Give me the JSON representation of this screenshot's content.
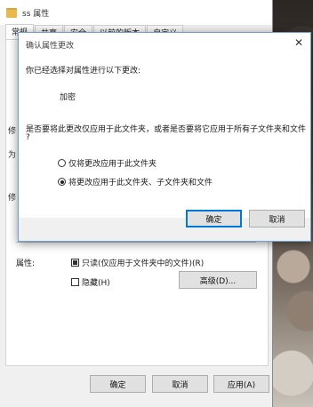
{
  "window": {
    "title": "ss 属性",
    "tabs": [
      "常规",
      "共享",
      "安全",
      "以前的版本",
      "自定义"
    ],
    "behind_fragments": [
      "修",
      "为",
      "修"
    ]
  },
  "attributes": {
    "label": "属性:",
    "readonly_label": "只读(仅应用于文件夹中的文件)(R)",
    "readonly_state": "mixed",
    "hidden_label": "隐藏(H)",
    "hidden_state": "unchecked",
    "advanced_button": "高级(D)..."
  },
  "footer": {
    "ok": "确定",
    "cancel": "取消",
    "apply": "应用(A)"
  },
  "dialog": {
    "title": "确认属性更改",
    "close_glyph": "✕",
    "intro": "你已经选择对属性进行以下更改:",
    "change": "加密",
    "question_line1": "是否要将此更改仅应用于此文件夹，或者是否要将它应用于所有子文件夹和文件",
    "question_line2": "?",
    "options": [
      {
        "label": "仅将更改应用于此文件夹",
        "selected": false
      },
      {
        "label": "将更改应用于此文件夹、子文件夹和文件",
        "selected": true
      }
    ],
    "ok": "确定",
    "cancel": "取消"
  }
}
